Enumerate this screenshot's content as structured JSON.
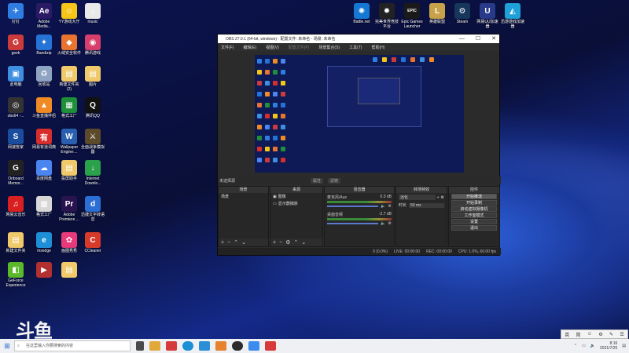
{
  "desktop": {
    "left_icons": [
      {
        "label": "钉钉",
        "color": "#2f7de1",
        "glyph": "✈"
      },
      {
        "label": "Adobe\nMedia...",
        "color": "#2a1a66",
        "glyph": "Ae"
      },
      {
        "label": "YY游戏大厅",
        "color": "#f5c518",
        "glyph": "☺"
      },
      {
        "label": "music",
        "color": "#e9e9e9",
        "glyph": "♪"
      },
      {
        "label": "geek",
        "color": "#cc3b3b",
        "glyph": "G"
      },
      {
        "label": "Bandizip",
        "color": "#2673d6",
        "glyph": "✦"
      },
      {
        "label": "火绒安全软件",
        "color": "#e8742f",
        "glyph": "◆"
      },
      {
        "label": "腾讯游戏",
        "color": "#d73e6b",
        "glyph": "◉"
      },
      {
        "label": "此电脑",
        "color": "#3f8fe0",
        "glyph": "▣"
      },
      {
        "label": "回收站",
        "color": "#8fa4c2",
        "glyph": "♻"
      },
      {
        "label": "新建文件夹\n(2)",
        "color": "#f0c96a",
        "glyph": "▤"
      },
      {
        "label": "图片",
        "color": "#f0c96a",
        "glyph": "▤"
      },
      {
        "label": "obs64 -...",
        "color": "#333333",
        "glyph": "◎"
      },
      {
        "label": "斗鱼直播伴侣",
        "color": "#f08a24",
        "glyph": "▲"
      },
      {
        "label": "格式工厂",
        "color": "#1f8f3a",
        "glyph": "▦"
      },
      {
        "label": "腾讯QQ",
        "color": "#111111",
        "glyph": "Q"
      },
      {
        "label": "网速管家",
        "color": "#1a4d9e",
        "glyph": "S"
      },
      {
        "label": "网易有道词典",
        "color": "#d82d2d",
        "glyph": "有"
      },
      {
        "label": "Wallpaper\nEngine:...",
        "color": "#2a5fb0",
        "glyph": "W"
      },
      {
        "label": "全面战争模拟\n器",
        "color": "#5c4a2a",
        "glyph": "⚔"
      },
      {
        "label": "Onboard\nMemor...",
        "color": "#222222",
        "glyph": "G"
      },
      {
        "label": "百度网盘",
        "color": "#4b86f0",
        "glyph": "☁"
      },
      {
        "label": "投屏助手",
        "color": "#f0c96a",
        "glyph": "▤"
      },
      {
        "label": "Internet\nDownlo...",
        "color": "#2aa14a",
        "glyph": "↓"
      },
      {
        "label": "网易云音乐",
        "color": "#d92020",
        "glyph": "♫"
      },
      {
        "label": "格式工厂",
        "color": "#d7d7d7",
        "glyph": "▦"
      },
      {
        "label": "Adobe\nPremiere ...",
        "color": "#2a1450",
        "glyph": "Pr"
      },
      {
        "label": "迅捷文字转语\n音",
        "color": "#2b6ed4",
        "glyph": "d"
      },
      {
        "label": "新建文件夹",
        "color": "#f0c96a",
        "glyph": "▤"
      },
      {
        "label": "msedge",
        "color": "#1e8fd6",
        "glyph": "e"
      },
      {
        "label": "画图秀秀",
        "color": "#e83a7a",
        "glyph": "✿"
      },
      {
        "label": "CCleaner",
        "color": "#d83a2a",
        "glyph": "C"
      },
      {
        "label": "GeForce\nExperience",
        "color": "#5ab82a",
        "glyph": "◧"
      },
      {
        "label": "",
        "color": "#b33030",
        "glyph": "▶"
      },
      {
        "label": "",
        "color": "#f0c96a",
        "glyph": "▤"
      }
    ],
    "top_icons": [
      {
        "label": "Battle.net",
        "color": "#1478d4",
        "glyph": "✺"
      },
      {
        "label": "完美世界竞技\n平台",
        "color": "#222222",
        "glyph": "✹"
      },
      {
        "label": "Epic Games\nLauncher",
        "color": "#1a1a1a",
        "glyph": "EPIC"
      },
      {
        "label": "英雄联盟",
        "color": "#c8a24a",
        "glyph": "L"
      },
      {
        "label": "Steam",
        "color": "#16365c",
        "glyph": "⚙"
      },
      {
        "label": "网易UU加速\n器",
        "color": "#2a3a8a",
        "glyph": "U"
      },
      {
        "label": "迅游游戏加速\n器",
        "color": "#1fa0d8",
        "glyph": "◭"
      }
    ]
  },
  "obs": {
    "title": "OBS 27.0.1 (64-bit, windows) - 配置文件: 未命名 - 场景: 未命名",
    "menu": [
      "文件(F)",
      "编辑(E)",
      "视图(V)",
      "配置文件(P)",
      "场景集合(S)",
      "工具(T)",
      "帮助(H)"
    ],
    "status_row": {
      "label": "未选择源",
      "props": "属性",
      "filters": "滤镜"
    },
    "docks": {
      "scenes": {
        "header": "场景",
        "items": [
          "场景"
        ]
      },
      "sources": {
        "header": "来源",
        "items": [
          "图像",
          "显示器捕获"
        ]
      },
      "mixer": {
        "header": "混音器",
        "channels": [
          {
            "name": "麦克风/Aux",
            "db": "0.0 dB"
          },
          {
            "name": "桌面音频",
            "db": "-2.7 dB"
          }
        ]
      },
      "transitions": {
        "header": "转场特效",
        "type": "淡化",
        "duration_label": "时长",
        "duration": "50 ms"
      },
      "controls": {
        "header": "控件",
        "buttons": [
          "开始推流",
          "开始录制",
          "启动虚拟摄像机",
          "工作室模式",
          "设置",
          "退出"
        ]
      }
    },
    "statusbar": {
      "dropped": "0 (0.0%)",
      "live": "LIVE: 00:00:00",
      "rec": "REC: 00:00:00",
      "cpu": "CPU: 1.0%, 60.00 fps"
    }
  },
  "taskbar": {
    "search_placeholder": "在这里输入你要搜索的内容",
    "time": "8:16",
    "date": "2021/7/25",
    "ime": [
      "英",
      "简",
      "☺",
      "⚙",
      "✎",
      "☰"
    ]
  },
  "watermark": "斗鱼"
}
